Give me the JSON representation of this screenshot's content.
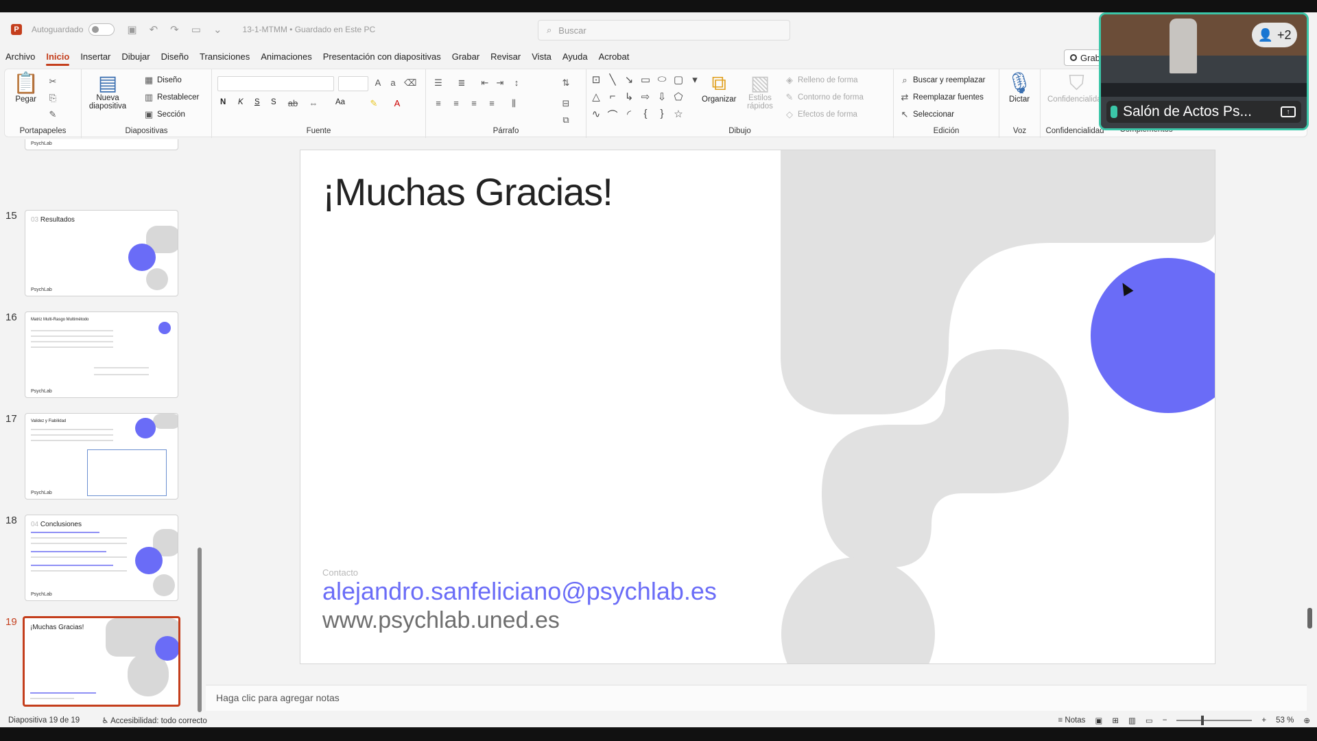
{
  "titlebar": {
    "autosave_label": "Autoguardado",
    "doc_title": "13-1-MTMM • Guardado en Este PC",
    "search_placeholder": "Buscar"
  },
  "menu": {
    "tabs": [
      "Archivo",
      "Inicio",
      "Insertar",
      "Dibujar",
      "Diseño",
      "Transiciones",
      "Animaciones",
      "Presentación con diapositivas",
      "Grabar",
      "Revisar",
      "Vista",
      "Ayuda",
      "Acrobat"
    ],
    "active": "Inicio",
    "record_label": "Grab"
  },
  "ribbon": {
    "clipboard": {
      "paste": "Pegar",
      "group": "Portapapeles"
    },
    "slides": {
      "new_slide": "Nueva diapositiva",
      "layout": "Diseño",
      "reset": "Restablecer",
      "section": "Sección",
      "group": "Diapositivas"
    },
    "font": {
      "group": "Fuente",
      "bold": "N",
      "italic": "K",
      "underline": "S",
      "strike": "S",
      "case": "Aa"
    },
    "paragraph": {
      "group": "Párrafo"
    },
    "drawing": {
      "arrange": "Organizar",
      "quick_styles": "Estilos rápidos",
      "fill": "Relleno de forma",
      "outline": "Contorno de forma",
      "effects": "Efectos de forma",
      "group": "Dibujo"
    },
    "editing": {
      "find": "Buscar y reemplazar",
      "replace_fonts": "Reemplazar fuentes",
      "select": "Seleccionar",
      "group": "Edición"
    },
    "voice": {
      "dictate": "Dictar",
      "group": "Voz"
    },
    "sensitivity": {
      "label": "Confidencialidad",
      "group": "Confidencialidad",
      "addins_group": "Complementos"
    }
  },
  "video": {
    "room_name": "Salón de Actos Ps...",
    "participants": "+2"
  },
  "thumbnails": [
    {
      "num": "15",
      "section": "03",
      "title": "Resultados",
      "brand": "PsychLab"
    },
    {
      "num": "16",
      "section": "",
      "title": "Matriz Multi-Rasgo Multimétodo",
      "brand": "PsychLab"
    },
    {
      "num": "17",
      "section": "",
      "title": "Validez y Fiabilidad",
      "brand": "PsychLab"
    },
    {
      "num": "18",
      "section": "04",
      "title": "Conclusiones",
      "brand": "PsychLab"
    },
    {
      "num": "19",
      "section": "",
      "title": "¡Muchas Gracias!",
      "brand": ""
    }
  ],
  "slide": {
    "title": "¡Muchas Gracias!",
    "contact_label": "Contacto",
    "email": "alejandro.sanfeliciano@psychlab.es",
    "website": "www.psychlab.uned.es",
    "accent_color": "#6a6cf7"
  },
  "notes": {
    "placeholder": "Haga clic para agregar notas"
  },
  "status": {
    "slide_info": "Diapositiva 19 de 19",
    "accessibility": "Accesibilidad: todo correcto",
    "notes_btn": "Notas",
    "zoom": "53 %"
  }
}
